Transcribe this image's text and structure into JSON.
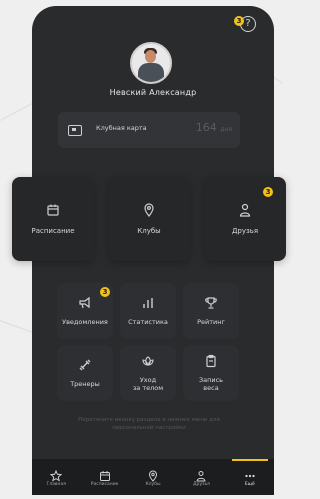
{
  "profile": {
    "name": "Невский Александр",
    "help_badge": "3"
  },
  "club_card": {
    "label": "Клубная карта",
    "days": "164",
    "days_unit": "дня"
  },
  "main_tiles": [
    {
      "label": "Расписание",
      "icon": "calendar-icon",
      "badge": ""
    },
    {
      "label": "Клубы",
      "icon": "location-pin-icon",
      "badge": ""
    },
    {
      "label": "Друзья",
      "icon": "person-icon",
      "badge": "3"
    }
  ],
  "grid_tiles": [
    {
      "label": "Уведомления",
      "icon": "megaphone-icon",
      "badge": "3"
    },
    {
      "label": "Статистика",
      "icon": "bar-chart-icon",
      "badge": ""
    },
    {
      "label": "Рейтинг",
      "icon": "trophy-icon",
      "badge": ""
    },
    {
      "label": "Тренеры",
      "icon": "dumbbell-icon",
      "badge": ""
    },
    {
      "label": "Уход\nза телом",
      "icon": "lotus-icon",
      "badge": ""
    },
    {
      "label": "Запись\nвеса",
      "icon": "clipboard-icon",
      "badge": ""
    }
  ],
  "hint": "Перетяните иконку раздела в нижнее меню для персональной настройки",
  "tabbar": [
    {
      "label": "Главная",
      "icon": "star-icon",
      "active": false
    },
    {
      "label": "Расписание",
      "icon": "calendar-icon",
      "active": false
    },
    {
      "label": "Клубы",
      "icon": "location-pin-icon",
      "active": false
    },
    {
      "label": "Друзья",
      "icon": "person-icon",
      "active": false
    },
    {
      "label": "Ещё",
      "icon": "more-dots-icon",
      "active": true
    }
  ],
  "colors": {
    "accent": "#f2c21b",
    "phone_bg": "#2a2b2d",
    "tile_bg": "#2e2f32"
  }
}
